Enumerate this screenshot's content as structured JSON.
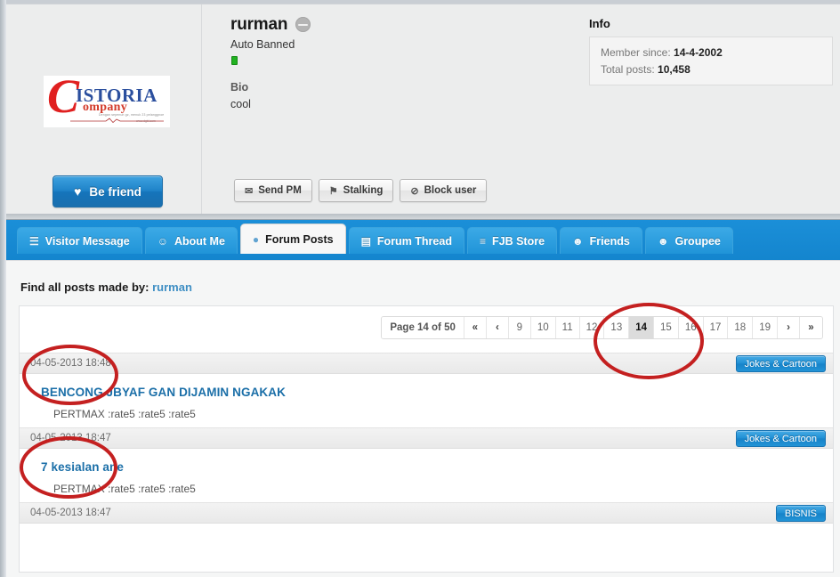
{
  "profile": {
    "logo": {
      "letter": "C",
      "name": "ISTORIA",
      "sub": "ompany",
      "tagline": "Dengan sepenuh gz, menuk 23 pelanggnoe",
      "url": "www.dgbl.com"
    },
    "be_friend_label": "Be friend",
    "be_friend_icon": "heart-icon",
    "username": "rurman",
    "status_icon": "neutral-face-icon",
    "user_title": "Auto Banned",
    "online_indicator": "online-dot",
    "bio_label": "Bio",
    "bio_text": "cool",
    "actions": [
      {
        "label": "Send PM",
        "icon": "envelope-icon",
        "glyph": "✉"
      },
      {
        "label": "Stalking",
        "icon": "flag-icon",
        "glyph": "⚑"
      },
      {
        "label": "Block user",
        "icon": "block-icon",
        "glyph": "⊘"
      }
    ],
    "info": {
      "title": "Info",
      "member_since_label": "Member since:",
      "member_since_value": "14-4-2002",
      "total_posts_label": "Total posts:",
      "total_posts_value": "10,458"
    }
  },
  "tabs": [
    {
      "label": "Visitor Message",
      "icon": "note-icon",
      "glyph": "☰",
      "active": false
    },
    {
      "label": "About Me",
      "icon": "person-icon",
      "glyph": "☺",
      "active": false
    },
    {
      "label": "Forum Posts",
      "icon": "speech-bubble-icon",
      "glyph": "●",
      "active": true
    },
    {
      "label": "Forum Thread",
      "icon": "calendar-icon",
      "glyph": "▤",
      "active": false
    },
    {
      "label": "FJB Store",
      "icon": "cart-icon",
      "glyph": "≡",
      "active": false
    },
    {
      "label": "Friends",
      "icon": "person-icon",
      "glyph": "☻",
      "active": false
    },
    {
      "label": "Groupee",
      "icon": "group-icon",
      "glyph": "☻",
      "active": false
    }
  ],
  "content": {
    "find_prefix": "Find all posts made by:",
    "find_user": "rurman",
    "pagination": {
      "page_label": "Page 14 of 50",
      "first_glyph": "«",
      "prev_glyph": "‹",
      "next_glyph": "›",
      "last_glyph": "»",
      "pages": [
        "9",
        "10",
        "11",
        "12",
        "13",
        "14",
        "15",
        "16",
        "17",
        "18",
        "19"
      ],
      "current": "14"
    },
    "posts": [
      {
        "date": "04-05-2013 18:48",
        "forum": "Jokes & Cartoon",
        "title": "BENCONG JBYAF GAN DIJAMIN NGAKAK",
        "snippet": "PERTMAX :rate5 :rate5 :rate5"
      },
      {
        "date": "04-05-2013 18:47",
        "forum": "Jokes & Cartoon",
        "title": "7 kesialan ane",
        "snippet": "PERTMAX :rate5 :rate5 :rate5"
      },
      {
        "date": "04-05-2013 18:47",
        "forum": "BISNIS",
        "title": "",
        "snippet": ""
      }
    ]
  },
  "colors": {
    "accent_blue": "#1b8fd8",
    "link_blue": "#1b6fa8",
    "annotation_red": "#c42020",
    "online_green": "#21b221"
  }
}
